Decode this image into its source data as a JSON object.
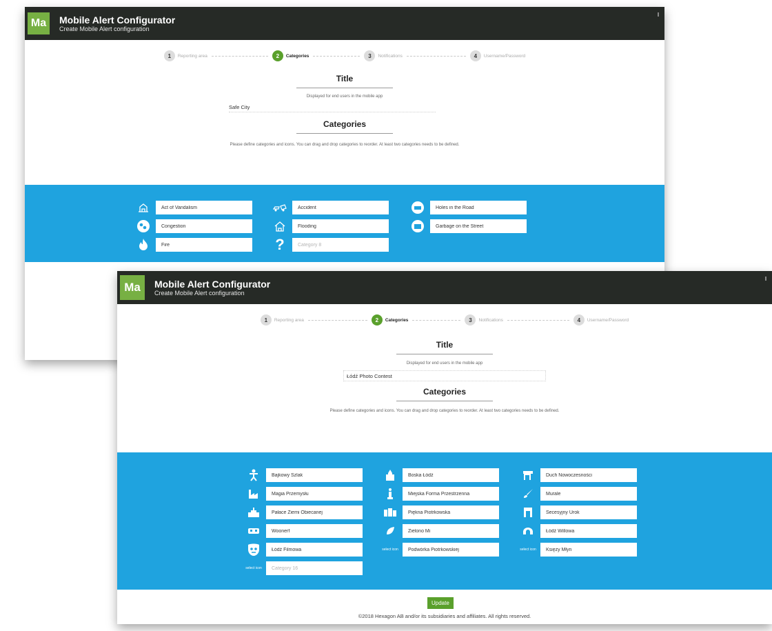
{
  "colors": {
    "accent_green": "#5aa02c",
    "logo_green": "#77b043",
    "header_dark": "#262a26",
    "category_blue": "#1fa3df"
  },
  "window1": {
    "logo": "Ma",
    "app_title": "Mobile Alert Configurator",
    "app_subtitle": "Create Mobile Alert configuration",
    "steps": [
      {
        "num": "1",
        "label": "Reporting area"
      },
      {
        "num": "2",
        "label": "Categories"
      },
      {
        "num": "3",
        "label": "Notifications"
      },
      {
        "num": "4",
        "label": "Username/Password"
      }
    ],
    "title_heading": "Title",
    "title_helper": "Displayed for end users in the mobile app",
    "title_value": "Safe City",
    "categories_heading": "Categories",
    "categories_helper": "Please define categories and icons. You can drag and drop categories to reorder. At least two categories needs to be defined.",
    "categories": [
      {
        "icon": "vandalism-icon",
        "label": "Act of Vandalism"
      },
      {
        "icon": "accident-icon",
        "label": "Accident"
      },
      {
        "icon": "hole-icon",
        "label": "Holes in the Road"
      },
      {
        "icon": "congestion-icon",
        "label": "Congestion"
      },
      {
        "icon": "flooding-icon",
        "label": "Flooding"
      },
      {
        "icon": "garbage-icon",
        "label": "Garbage on the Street"
      },
      {
        "icon": "fire-icon",
        "label": "Fire"
      },
      {
        "icon": "question-icon",
        "placeholder": "Category 8"
      }
    ]
  },
  "window2": {
    "logo": "Ma",
    "app_title": "Mobile Alert Configurator",
    "app_subtitle": "Create Mobile Alert configuration",
    "steps": [
      {
        "num": "1",
        "label": "Reporting area"
      },
      {
        "num": "2",
        "label": "Categories"
      },
      {
        "num": "3",
        "label": "Notifications"
      },
      {
        "num": "4",
        "label": "Username/Password"
      }
    ],
    "title_heading": "Title",
    "title_helper": "Displayed for end users in the mobile app",
    "title_value": "Łódź Photo Contest",
    "categories_heading": "Categories",
    "categories_helper": "Please define categories and icons. You can drag and drop categories to reorder. At least two categories needs to be defined.",
    "select_icon_text": "select icon",
    "categories": [
      {
        "icon": "figure-icon",
        "label": "Bajkowy Szlak"
      },
      {
        "icon": "church-icon",
        "label": "Boska Łódź"
      },
      {
        "icon": "chair-icon",
        "label": "Duch Nowoczesności"
      },
      {
        "icon": "factory-icon",
        "label": "Magia Przemysłu"
      },
      {
        "icon": "statue-icon",
        "label": "Miejska Forma Przestrzenna"
      },
      {
        "icon": "brush-icon",
        "label": "Murale"
      },
      {
        "icon": "palace-icon",
        "label": "Pałace Ziemi Obiecanej"
      },
      {
        "icon": "tenement-icon",
        "label": "Piękna Piotrkowska"
      },
      {
        "icon": "doorway-icon",
        "label": "Secesyjny Urok"
      },
      {
        "icon": "woonerf-icon",
        "label": "Woonerf"
      },
      {
        "icon": "leaf-icon",
        "label": "Zielono Mi"
      },
      {
        "icon": "arch-icon",
        "label": "Łódź Willowa"
      },
      {
        "icon": "mask-icon",
        "label": "Łódź Filmowa"
      },
      {
        "icon": "select-icon",
        "label": "Podwórka Piotrkowskiej"
      },
      {
        "icon": "select-icon",
        "label": "Księży Młyn"
      },
      {
        "icon": "select-icon",
        "placeholder": "Category 16"
      }
    ],
    "update_label": "Update",
    "copyright": "©2018 Hexagon AB and/or its subsidiaries and affiliates. All rights reserved."
  }
}
